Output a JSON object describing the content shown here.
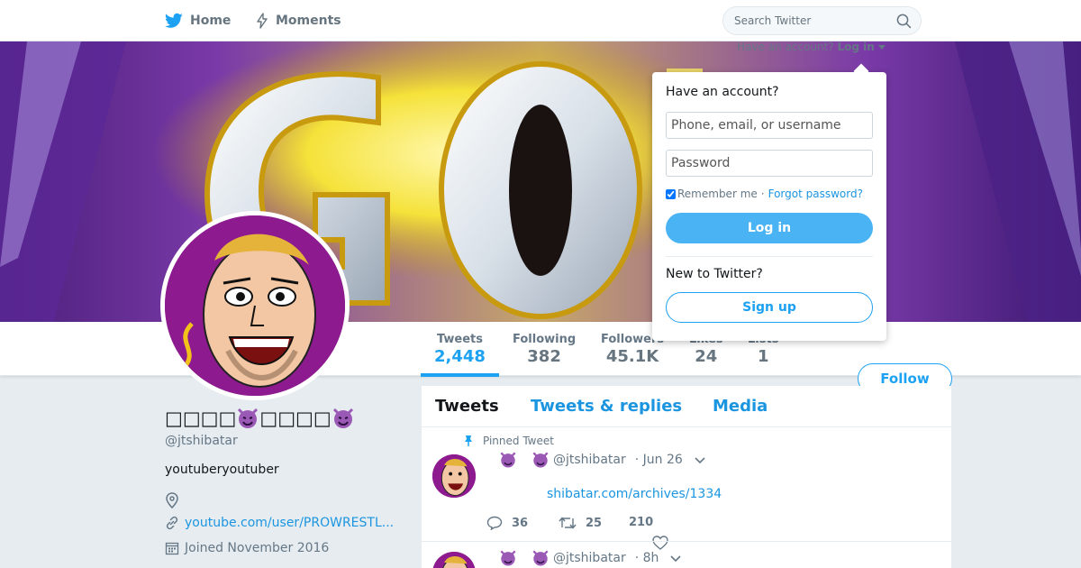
{
  "nav": {
    "home_label": "Home",
    "moments_label": "Moments",
    "search_placeholder": "Search Twitter"
  },
  "login": {
    "prompt": "Have an account?",
    "trigger_label": "Log in",
    "panel_title": "Have an account?",
    "username_placeholder": "Phone, email, or username",
    "password_placeholder": "Password",
    "remember_label": "Remember me",
    "separator": "·",
    "forgot_label": "Forgot password?",
    "login_button": "Log in",
    "new_prompt": "New to Twitter?",
    "signup_button": "Sign up"
  },
  "banner": {
    "text": "GO"
  },
  "profile": {
    "name_glyphs": "□□□□",
    "handle": "@jtshibatar",
    "bio": "youtuberyoutuber",
    "url": "youtube.com/user/PROWRESTL...",
    "joined": "Joined November 2016"
  },
  "stats": [
    {
      "label": "Tweets",
      "value": "2,448"
    },
    {
      "label": "Following",
      "value": "382"
    },
    {
      "label": "Followers",
      "value": "45.1K"
    },
    {
      "label": "Likes",
      "value": "24"
    },
    {
      "label": "Lists",
      "value": "1"
    }
  ],
  "follow_button": "Follow",
  "timeline": {
    "tabs": [
      "Tweets",
      "Tweets & replies",
      "Media"
    ],
    "pinned_label": "Pinned Tweet",
    "tweets": [
      {
        "handle": "@jtshibatar",
        "time": "· Jun 26",
        "link": "shibatar.com/archives/1334",
        "replies": "36",
        "retweets": "25",
        "likes": "210"
      },
      {
        "handle": "@jtshibatar",
        "time": "· 8h"
      }
    ]
  },
  "colors": {
    "accent": "#1da1f2",
    "link": "#1b95e0",
    "avatar_bg": "#8e1a8f",
    "banner_yellow": "#f5e23a"
  }
}
